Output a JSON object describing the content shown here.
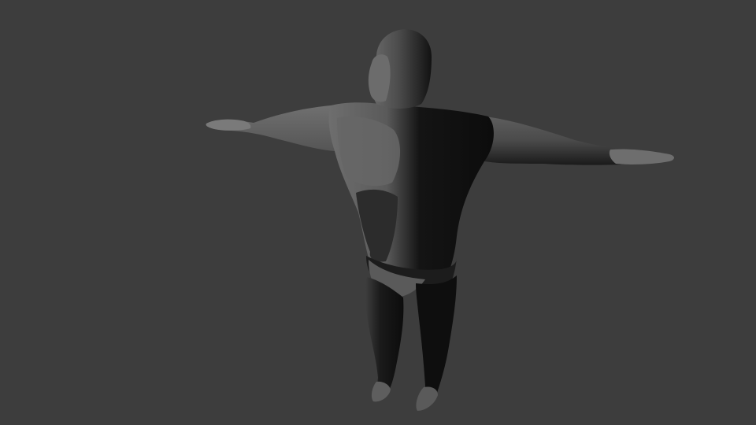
{
  "scene": {
    "background_color": "#3d3d3d",
    "subject": "character-model",
    "pose": "t-pose",
    "shading": "solid-gray",
    "colors": {
      "lit": "#6a6a6a",
      "mid": "#4a4a4a",
      "shadow": "#101010"
    }
  }
}
